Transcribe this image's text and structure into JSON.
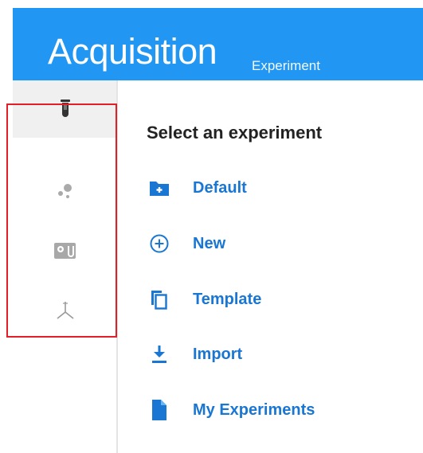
{
  "header": {
    "title": "Acquisition",
    "subtitle": "Experiment"
  },
  "sidebar": {
    "items": [
      {
        "name": "test-tube-icon",
        "active": true
      },
      {
        "name": "particles-icon",
        "active": false
      },
      {
        "name": "cytometer-settings-icon",
        "active": false
      },
      {
        "name": "axes-icon",
        "active": false
      }
    ]
  },
  "main": {
    "title": "Select an experiment",
    "items": [
      {
        "label": "Default",
        "icon": "folder-plus-icon"
      },
      {
        "label": "New",
        "icon": "circle-plus-icon"
      },
      {
        "label": "Template",
        "icon": "copy-icon"
      },
      {
        "label": "Import",
        "icon": "import-icon"
      },
      {
        "label": "My Experiments",
        "icon": "file-icon"
      }
    ]
  },
  "colors": {
    "header_bg": "#2196f3",
    "accent": "#1976d2",
    "highlight": "#e21f26"
  }
}
